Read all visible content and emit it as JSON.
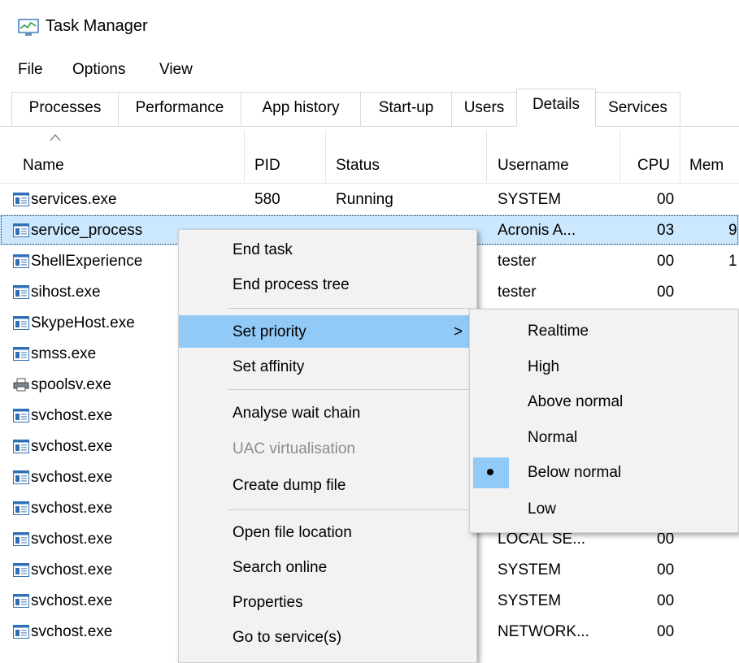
{
  "window": {
    "title": "Task Manager",
    "icon": "task-manager-icon"
  },
  "menu": [
    "File",
    "Options",
    "View"
  ],
  "tabs": [
    "Processes",
    "Performance",
    "App history",
    "Start-up",
    "Users",
    "Details",
    "Services"
  ],
  "active_tab": "Details",
  "columns": [
    "Name",
    "PID",
    "Status",
    "Username",
    "CPU",
    "Mem"
  ],
  "rows": [
    {
      "name": "services.exe",
      "pid": "580",
      "status": "Running",
      "user": "SYSTEM",
      "cpu": "00",
      "mem": ""
    },
    {
      "name": "service_process",
      "pid": "",
      "status": "",
      "user": "Acronis A...",
      "cpu": "03",
      "mem": "9"
    },
    {
      "name": "ShellExperience",
      "pid": "",
      "status": "",
      "user": "tester",
      "cpu": "00",
      "mem": "1"
    },
    {
      "name": "sihost.exe",
      "pid": "",
      "status": "",
      "user": "tester",
      "cpu": "00",
      "mem": ""
    },
    {
      "name": "SkypeHost.exe",
      "pid": "",
      "status": "",
      "user": "",
      "cpu": "",
      "mem": ""
    },
    {
      "name": "smss.exe",
      "pid": "",
      "status": "",
      "user": "",
      "cpu": "",
      "mem": ""
    },
    {
      "name": "spoolsv.exe",
      "pid": "",
      "status": "",
      "user": "",
      "cpu": "",
      "mem": ""
    },
    {
      "name": "svchost.exe",
      "pid": "",
      "status": "",
      "user": "",
      "cpu": "",
      "mem": ""
    },
    {
      "name": "svchost.exe",
      "pid": "",
      "status": "",
      "user": "",
      "cpu": "",
      "mem": ""
    },
    {
      "name": "svchost.exe",
      "pid": "",
      "status": "",
      "user": "",
      "cpu": "",
      "mem": ""
    },
    {
      "name": "svchost.exe",
      "pid": "",
      "status": "",
      "user": "",
      "cpu": "",
      "mem": ""
    },
    {
      "name": "svchost.exe",
      "pid": "",
      "status": "",
      "user": "LOCAL SE...",
      "cpu": "00",
      "mem": ""
    },
    {
      "name": "svchost.exe",
      "pid": "",
      "status": "",
      "user": "SYSTEM",
      "cpu": "00",
      "mem": ""
    },
    {
      "name": "svchost.exe",
      "pid": "",
      "status": "",
      "user": "SYSTEM",
      "cpu": "00",
      "mem": ""
    },
    {
      "name": "svchost.exe",
      "pid": "",
      "status": "",
      "user": "NETWORK...",
      "cpu": "00",
      "mem": ""
    }
  ],
  "context_menu": {
    "items": [
      "End task",
      "End process tree",
      "Set priority",
      "Set affinity",
      "Analyse wait chain",
      "UAC virtualisation",
      "Create dump file",
      "Open file location",
      "Search online",
      "Properties",
      "Go to service(s)"
    ],
    "submenu_arrow": ">"
  },
  "priority_menu": {
    "items": [
      "Realtime",
      "High",
      "Above normal",
      "Normal",
      "Below normal",
      "Low"
    ],
    "selected": "Below normal"
  },
  "colors": {
    "selection": "#cce8ff",
    "menu_hover": "#91c9f7",
    "menu_bg": "#f2f2f2",
    "disabled_text": "#8c8c8c"
  }
}
